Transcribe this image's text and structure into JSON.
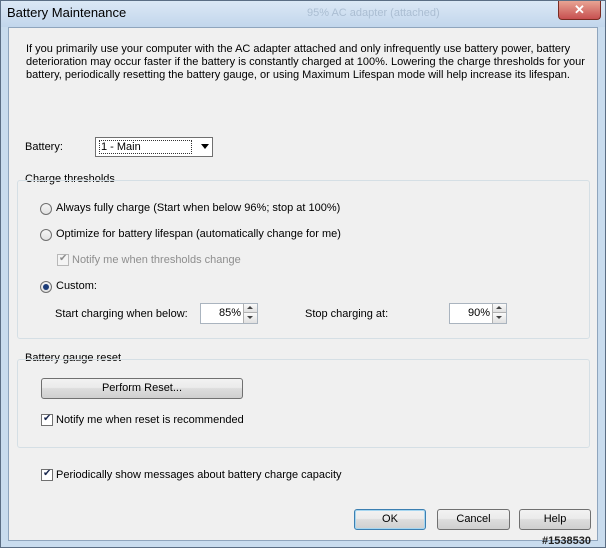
{
  "window": {
    "title": "Battery Maintenance",
    "background_title": "95% AC adapter (attached)",
    "close_symbol": "✕"
  },
  "intro_text": "If you primarily use your computer with the AC adapter attached and only infrequently use battery power, battery deterioration may occur faster if the battery is constantly charged at 100%. Lowering the charge thresholds for your battery, periodically resetting the battery gauge, or using Maximum Lifespan mode will help increase its lifespan.",
  "battery": {
    "label": "Battery:",
    "selected": "1 - Main"
  },
  "charge_thresholds": {
    "title": "Charge thresholds",
    "always_full": {
      "label": "Always fully charge (Start when below 96%; stop at 100%)",
      "selected": false
    },
    "optimize": {
      "label": "Optimize for battery lifespan (automatically change for me)",
      "selected": false
    },
    "notify_thresholds": {
      "label": "Notify me when thresholds change",
      "checked": true,
      "enabled": false
    },
    "custom": {
      "label": "Custom:",
      "selected": true
    },
    "start_label": "Start charging when below:",
    "start_value": "85%",
    "stop_label": "Stop charging at:",
    "stop_value": "90%"
  },
  "gauge_reset": {
    "title": "Battery gauge reset",
    "button_label": "Perform Reset...",
    "notify": {
      "label": "Notify me when reset is recommended",
      "checked": true
    }
  },
  "periodic_messages": {
    "label": "Periodically show messages about battery charge capacity",
    "checked": true
  },
  "buttons": {
    "ok": "OK",
    "cancel": "Cancel",
    "help": "Help"
  },
  "watermark": "#1538530"
}
